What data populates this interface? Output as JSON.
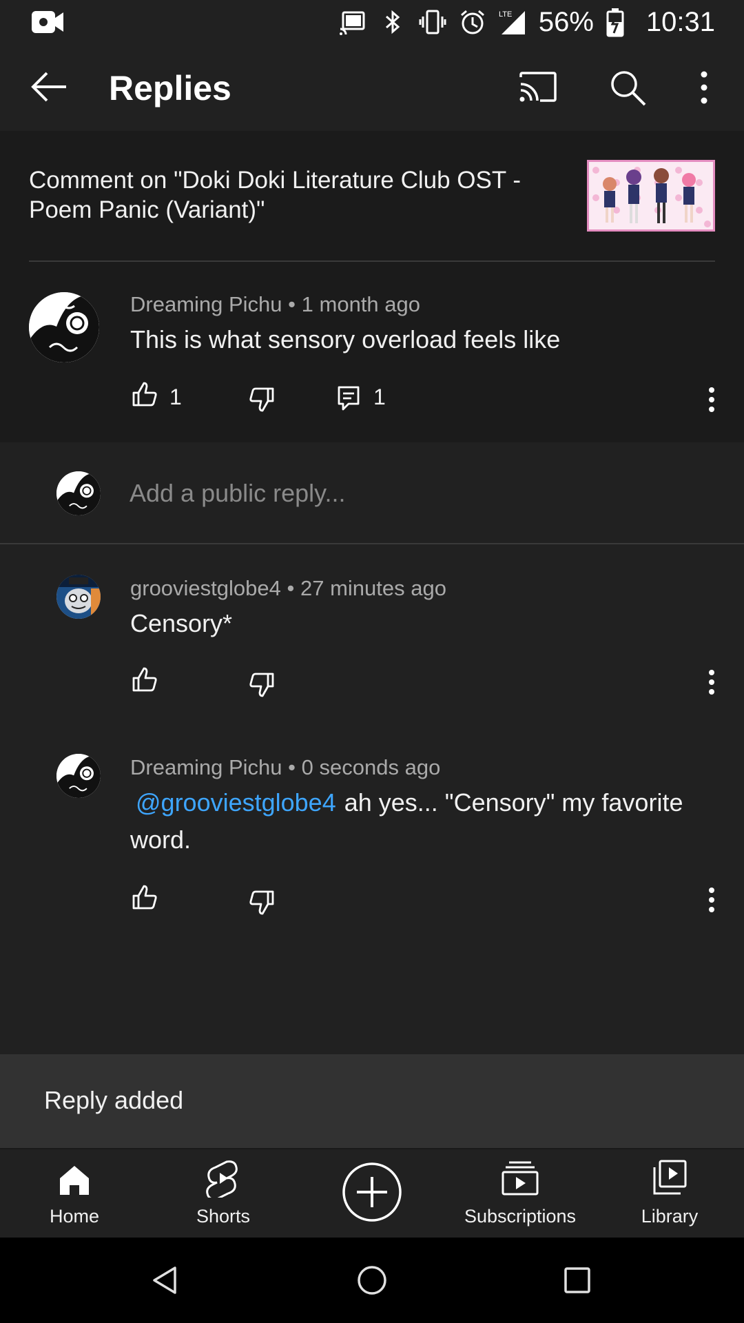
{
  "status_bar": {
    "battery": "56%",
    "time": "10:31",
    "network": "LTE"
  },
  "app_bar": {
    "title": "Replies"
  },
  "context": {
    "text": "Comment on \"Doki Doki Literature Club OST - Poem Panic (Variant)\""
  },
  "parent_comment": {
    "author": "Dreaming Pichu",
    "time": "1 month ago",
    "text": "This is what sensory overload feels like",
    "likes": "1",
    "replies": "1"
  },
  "reply_box": {
    "placeholder": "Add a public reply..."
  },
  "replies": [
    {
      "author": "grooviestglobe4",
      "time": "27 minutes ago",
      "text": "Censory*"
    },
    {
      "author": "Dreaming Pichu",
      "time": "0 seconds ago",
      "mention": "@grooviestglobe4",
      "text": "ah yes... \"Censory\" my favorite word."
    }
  ],
  "separator": "•",
  "snackbar": {
    "text": "Reply added"
  },
  "bottom_nav": [
    {
      "label": "Home",
      "icon": "home-icon"
    },
    {
      "label": "Shorts",
      "icon": "shorts-icon"
    },
    {
      "label": "",
      "icon": "create-icon"
    },
    {
      "label": "Subscriptions",
      "icon": "subscriptions-icon"
    },
    {
      "label": "Library",
      "icon": "library-icon"
    }
  ],
  "colors": {
    "background": "#212121",
    "link": "#3ea6ff",
    "meta": "#aaaaaa",
    "snackbar": "#323232"
  }
}
